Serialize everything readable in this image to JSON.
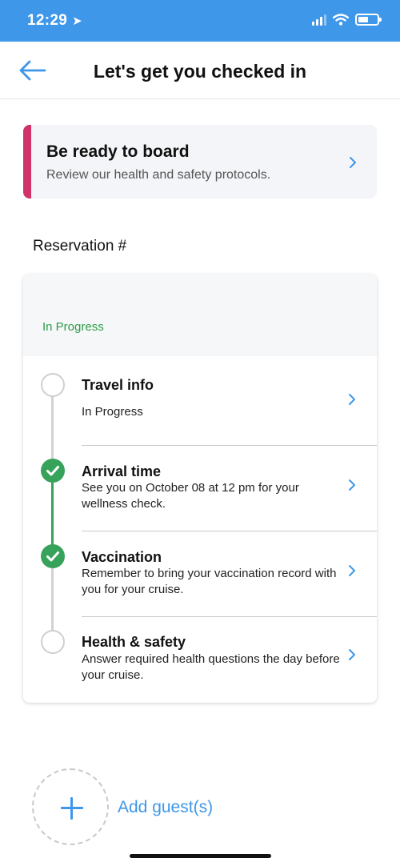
{
  "status_bar": {
    "time": "12:29",
    "location_icon": "location-arrow-icon",
    "signal_icon": "cellular-signal-icon",
    "wifi_icon": "wifi-icon",
    "battery_icon": "battery-icon",
    "bar_color": "#3e97e8"
  },
  "header": {
    "back_icon": "arrow-left-icon",
    "title": "Let's get you checked in"
  },
  "banner": {
    "title": "Be ready to board",
    "subtitle": "Review our health and safety protocols.",
    "accent_color": "#d0336a",
    "chevron_icon": "chevron-right-icon"
  },
  "reservation": {
    "label": "Reservation #"
  },
  "checkin_card": {
    "status": "In Progress",
    "status_color": "#2e9a48",
    "steps": [
      {
        "title": "Travel info",
        "description": "In Progress",
        "completed": false
      },
      {
        "title": "Arrival time",
        "description": "See you on October 08 at 12 pm for your wellness check.",
        "completed": true
      },
      {
        "title": "Vaccination",
        "description": "Remember to bring your vaccination record with you for your cruise.",
        "completed": true
      },
      {
        "title": "Health & safety",
        "description": "Answer required health questions the day before your cruise.",
        "completed": false
      }
    ]
  },
  "add_guest": {
    "label": "Add guest(s)",
    "icon": "plus-icon"
  },
  "colors": {
    "accent_blue": "#3e97e8",
    "complete_green": "#37a25a"
  }
}
